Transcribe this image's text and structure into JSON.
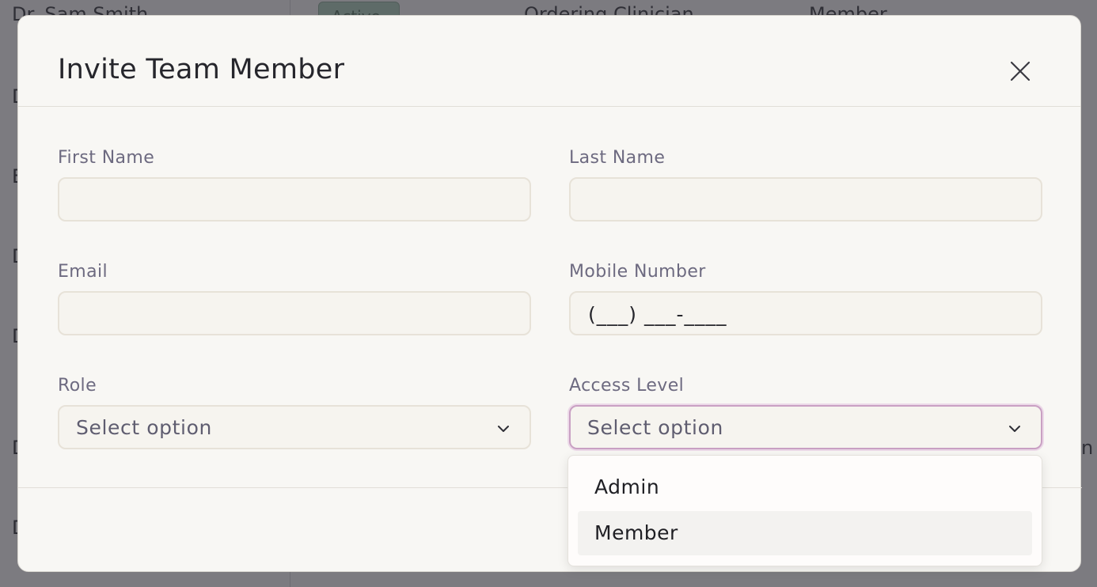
{
  "background": {
    "row1_name": "Dr. Sam Smith",
    "row1_status": "Active",
    "row1_role": "Ordering Clinician",
    "row1_access": "Member",
    "row_letter": "D",
    "row_letter_b": "E",
    "right_clip": "n"
  },
  "modal": {
    "title": "Invite Team Member",
    "close_icon": "close-icon",
    "fields": {
      "first_name_label": "First Name",
      "last_name_label": "Last Name",
      "email_label": "Email",
      "mobile_label": "Mobile Number",
      "mobile_value": "(___) ___-____",
      "role_label": "Role",
      "role_value": "Select option",
      "access_label": "Access Level",
      "access_value": "Select option"
    },
    "access_dropdown": {
      "options": [
        "Admin",
        "Member"
      ],
      "highlighted": "Member"
    }
  },
  "colors": {
    "modal_bg": "#f8f7f4",
    "focus_border": "#c9a0c3",
    "label_color": "#6d6a80"
  }
}
